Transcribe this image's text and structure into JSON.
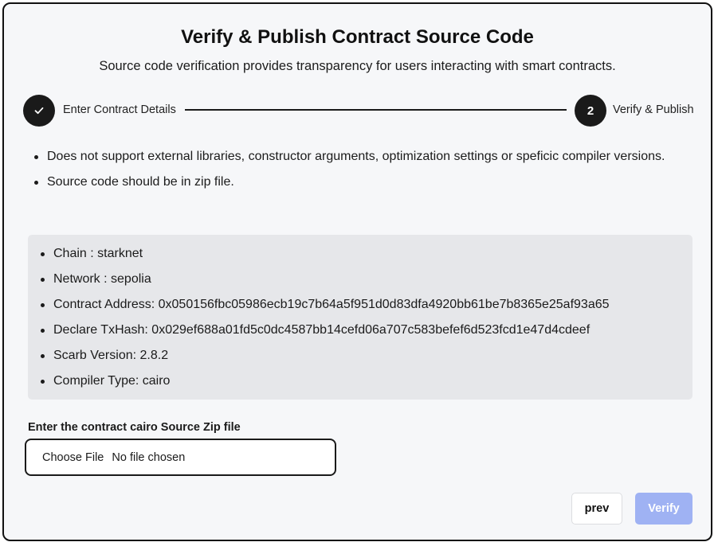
{
  "header": {
    "title": "Verify & Publish Contract Source Code",
    "subtitle": "Source code verification provides transparency for users interacting with smart contracts."
  },
  "stepper": {
    "steps": [
      {
        "label": "Enter Contract Details",
        "status": "completed",
        "icon": "check-icon"
      },
      {
        "label": "Verify & Publish",
        "status": "current",
        "number": "2"
      }
    ]
  },
  "notes": [
    "Does not support external libraries, constructor arguments, optimization settings or speficic compiler versions.",
    "Source code should be in zip file."
  ],
  "details": [
    "Chain : starknet",
    "Network : sepolia",
    "Contract Address: 0x050156fbc05986ecb19c7b64a5f951d0d83dfa4920bb61be7b8365e25af93a65",
    "Declare TxHash: 0x029ef688a01fd5c0dc4587bb14cefd06a707c583befef6d523fcd1e47d4cdeef",
    "Scarb Version: 2.8.2",
    "Compiler Type: cairo"
  ],
  "upload": {
    "label": "Enter the contract cairo Source Zip file",
    "choose_label": "Choose File",
    "status": "No file chosen"
  },
  "actions": {
    "prev_label": "prev",
    "verify_label": "Verify"
  },
  "colors": {
    "primary_dark": "#1a1a1a",
    "info_bg": "#e6e7ea",
    "verify_disabled": "#9fb2f3"
  }
}
